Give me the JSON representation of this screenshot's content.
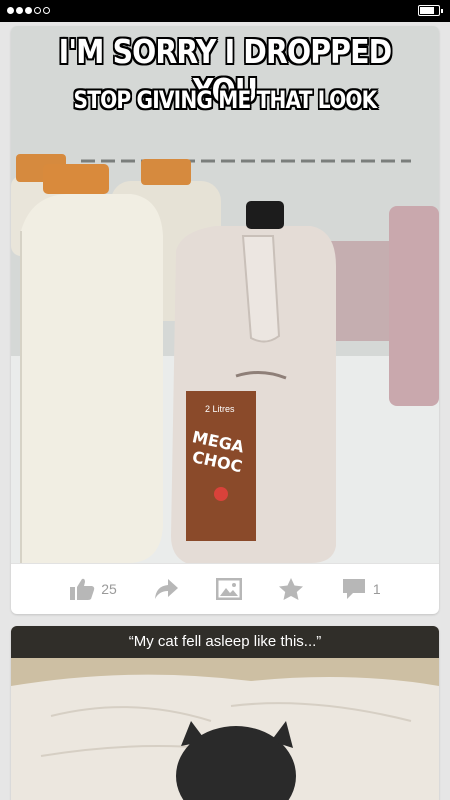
{
  "status_bar": {
    "signal_dots": 5,
    "signal_filled": 3,
    "battery_level": 0.8
  },
  "posts": [
    {
      "image": {
        "caption_top": "I'M SORRY I DROPPED YOU",
        "caption_bottom": "STOP GIVING ME THAT LOOK",
        "label_volume": "2 Litres",
        "label_brand_1": "MEGA",
        "label_brand_2": "CHOC"
      },
      "actions": {
        "like_icon": "thumbs-up-icon",
        "like_count": "25",
        "share_icon": "share-arrow-icon",
        "save_image_icon": "image-icon",
        "favorite_icon": "star-icon",
        "comment_icon": "speech-bubble-icon",
        "comment_count": "1"
      }
    },
    {
      "image": {
        "caption": "“My cat fell asleep like this...”"
      }
    }
  ],
  "colors": {
    "icon_gray": "#b7b7b7",
    "count_gray": "#9a9a9a",
    "background": "#e6e6e6"
  }
}
